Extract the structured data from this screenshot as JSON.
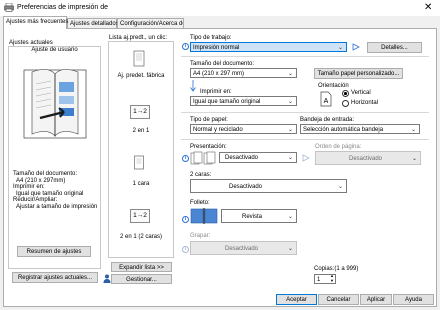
{
  "window": {
    "title": "Preferencias de impresión de",
    "close_glyph": "✕"
  },
  "tabs": [
    {
      "label": "Ajustes más frecuentes"
    },
    {
      "label": "Ajustes detallados"
    },
    {
      "label": "Configuración/Acerca de"
    }
  ],
  "left": {
    "current_settings_label": "Ajustes actuales",
    "user_settings_label": "Ajuste de usuario",
    "summary_lines": [
      "Tamaño del documento:",
      "  A4 (210 x 297mm)",
      "Imprimir en:",
      "  Igual que tamaño original",
      "Reducir/Ampliar:",
      "  Ajustar a tamaño de impresión"
    ],
    "summary_button": "Resumen de ajustes",
    "register_button": "Registrar ajustes actuales..."
  },
  "presets": {
    "header": "Lista aj.predt., un clic:",
    "items": [
      {
        "label": "Aj. predet. fábrica"
      },
      {
        "label": "2 en 1",
        "glyph": "1→2"
      },
      {
        "label": "1 cara"
      },
      {
        "label": "2 en 1 (2 caras)",
        "glyph": "1→2"
      }
    ],
    "expand_button": "Expandir lista >>",
    "manage_button": "Gestionar..."
  },
  "job": {
    "label": "Tipo de trabajo:",
    "value": "Impresión normal",
    "details_button": "Detalles..."
  },
  "doc_size": {
    "label": "Tamaño del documento:",
    "value": "A4 (210 x 297 mm)",
    "custom_button": "Tamaño papel personalizado..."
  },
  "print_on": {
    "label": "Imprimir en:",
    "value": "Igual que tamaño original"
  },
  "orientation": {
    "label": "Orientación",
    "options": [
      "Vertical",
      "Horizontal"
    ],
    "selected": "Vertical"
  },
  "paper_type": {
    "label": "Tipo de papel:",
    "value": "Normal y reciclado"
  },
  "input_tray": {
    "label": "Bandeja de entrada:",
    "value": "Selección automática bandeja"
  },
  "presentation": {
    "label": "Presentación:",
    "value": "Desactivado"
  },
  "page_order": {
    "label": "Orden de página:",
    "value": "Desactivado"
  },
  "two_sided": {
    "label": "2 caras:",
    "value": "Desactivado"
  },
  "booklet": {
    "label": "Folleto:",
    "value": "Revista"
  },
  "stapler": {
    "label": "Grapar:",
    "value": "Desactivado"
  },
  "copies": {
    "label": "Copias:(1 a 999)",
    "value": "1"
  },
  "footer": {
    "accept": "Aceptar",
    "cancel": "Cancelar",
    "apply": "Aplicar",
    "help": "Ayuda"
  },
  "colors": {
    "accent": "#0078d7",
    "info_blue": "#2b6fd6"
  }
}
